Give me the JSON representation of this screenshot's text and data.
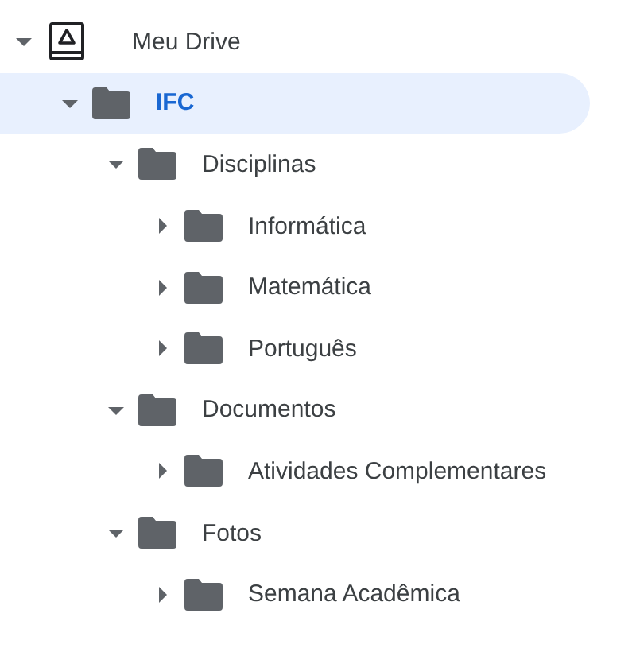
{
  "tree": [
    {
      "label": "Meu Drive",
      "kind": "drive",
      "expanded": true,
      "selected": false,
      "children": [
        {
          "label": "IFC",
          "kind": "folder",
          "expanded": true,
          "selected": true,
          "children": [
            {
              "label": "Disciplinas",
              "kind": "folder",
              "expanded": true,
              "selected": false,
              "children": [
                {
                  "label": "Informática",
                  "kind": "folder",
                  "expanded": false,
                  "selected": false
                },
                {
                  "label": "Matemática",
                  "kind": "folder",
                  "expanded": false,
                  "selected": false
                },
                {
                  "label": "Português",
                  "kind": "folder",
                  "expanded": false,
                  "selected": false
                }
              ]
            },
            {
              "label": "Documentos",
              "kind": "folder",
              "expanded": true,
              "selected": false,
              "children": [
                {
                  "label": "Atividades Complementares",
                  "kind": "folder",
                  "expanded": false,
                  "selected": false
                }
              ]
            },
            {
              "label": "Fotos",
              "kind": "folder",
              "expanded": true,
              "selected": false,
              "children": [
                {
                  "label": "Semana Acadêmica",
                  "kind": "folder",
                  "expanded": false,
                  "selected": false
                }
              ]
            }
          ]
        }
      ]
    }
  ]
}
